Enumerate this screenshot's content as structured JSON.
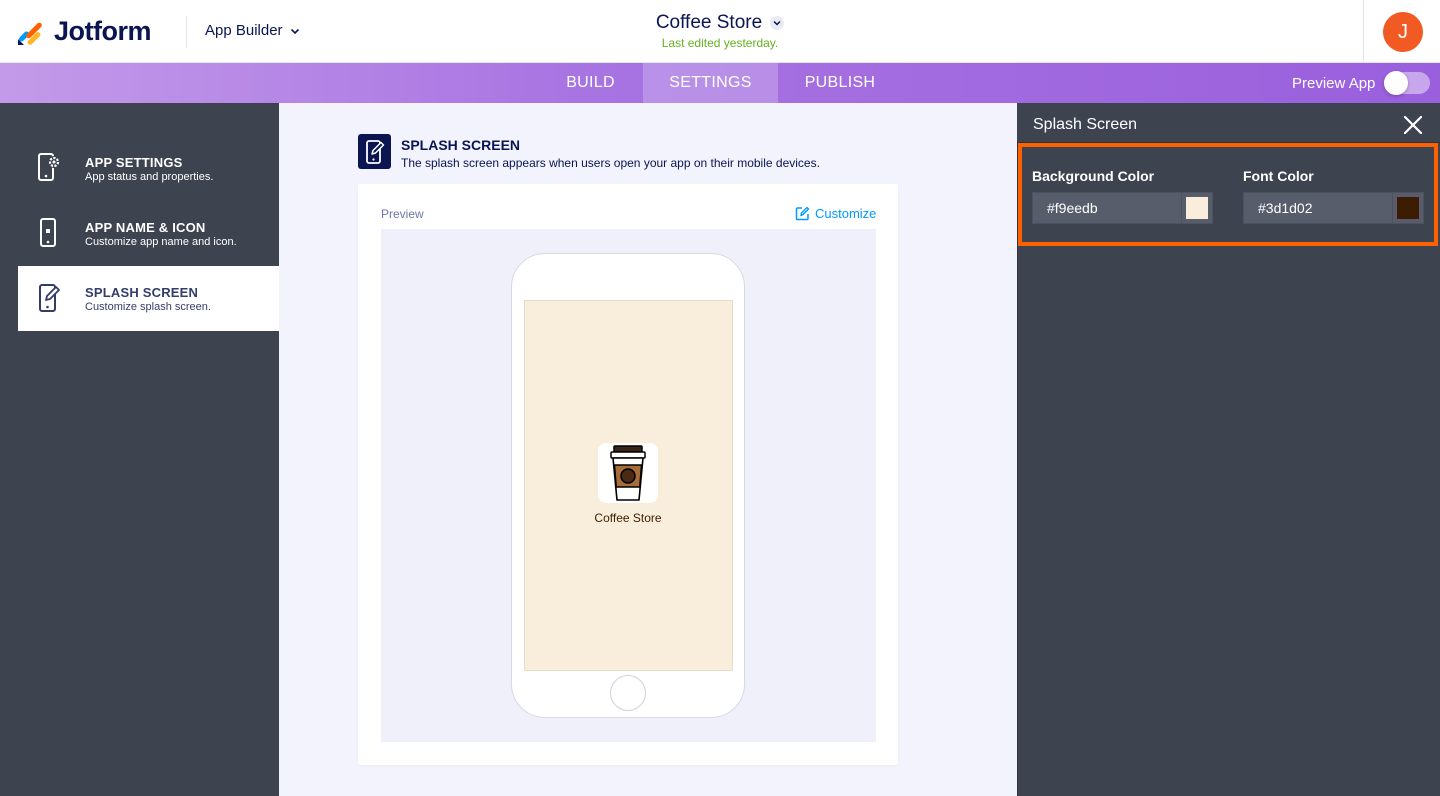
{
  "header": {
    "logo_text": "Jotform",
    "app_builder_label": "App Builder",
    "app_title": "Coffee Store",
    "last_edited": "Last edited yesterday.",
    "avatar_initial": "J"
  },
  "nav": {
    "tabs": [
      "BUILD",
      "SETTINGS",
      "PUBLISH"
    ],
    "active_tab": "SETTINGS",
    "preview_app_label": "Preview App",
    "preview_app_enabled": false
  },
  "sidebar": {
    "items": [
      {
        "title": "APP SETTINGS",
        "subtitle": "App status and properties.",
        "icon": "phone-gear-icon"
      },
      {
        "title": "APP NAME & ICON",
        "subtitle": "Customize app name and icon.",
        "icon": "phone-icon"
      },
      {
        "title": "SPLASH SCREEN",
        "subtitle": "Customize splash screen.",
        "icon": "phone-edit-icon"
      }
    ],
    "active_item": "SPLASH SCREEN"
  },
  "main": {
    "section_title": "SPLASH SCREEN",
    "section_description": "The splash screen appears when users open your app on their mobile devices.",
    "preview_label": "Preview",
    "customize_label": "Customize",
    "splash_app_name": "Coffee Store",
    "splash_icon": "coffee-cup-icon"
  },
  "panel": {
    "title": "Splash Screen",
    "background_color_label": "Background Color",
    "background_color_value": "#f9eedb",
    "font_color_label": "Font Color",
    "font_color_value": "#3d1d02"
  },
  "colors": {
    "brand_navy": "#0a1551",
    "accent_orange": "#ff6100",
    "panel_dark": "#3e4350",
    "link_blue": "#0099ff",
    "edited_green": "#64b11f"
  }
}
